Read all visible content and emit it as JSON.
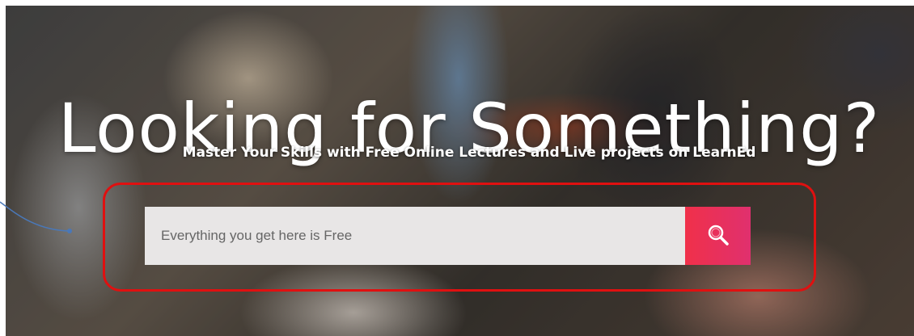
{
  "hero": {
    "headline": "Looking for Something?",
    "subline": "Master Your Skills with Free Online Lectures and Live projects on LearnEd"
  },
  "search": {
    "placeholder": "Everything you get here is Free",
    "button_icon": "search-icon"
  },
  "colors": {
    "highlight_border": "#e01010",
    "search_button_start": "#f0304a",
    "search_button_end": "#e0306e",
    "annotation_arrow": "#4a78b8"
  }
}
